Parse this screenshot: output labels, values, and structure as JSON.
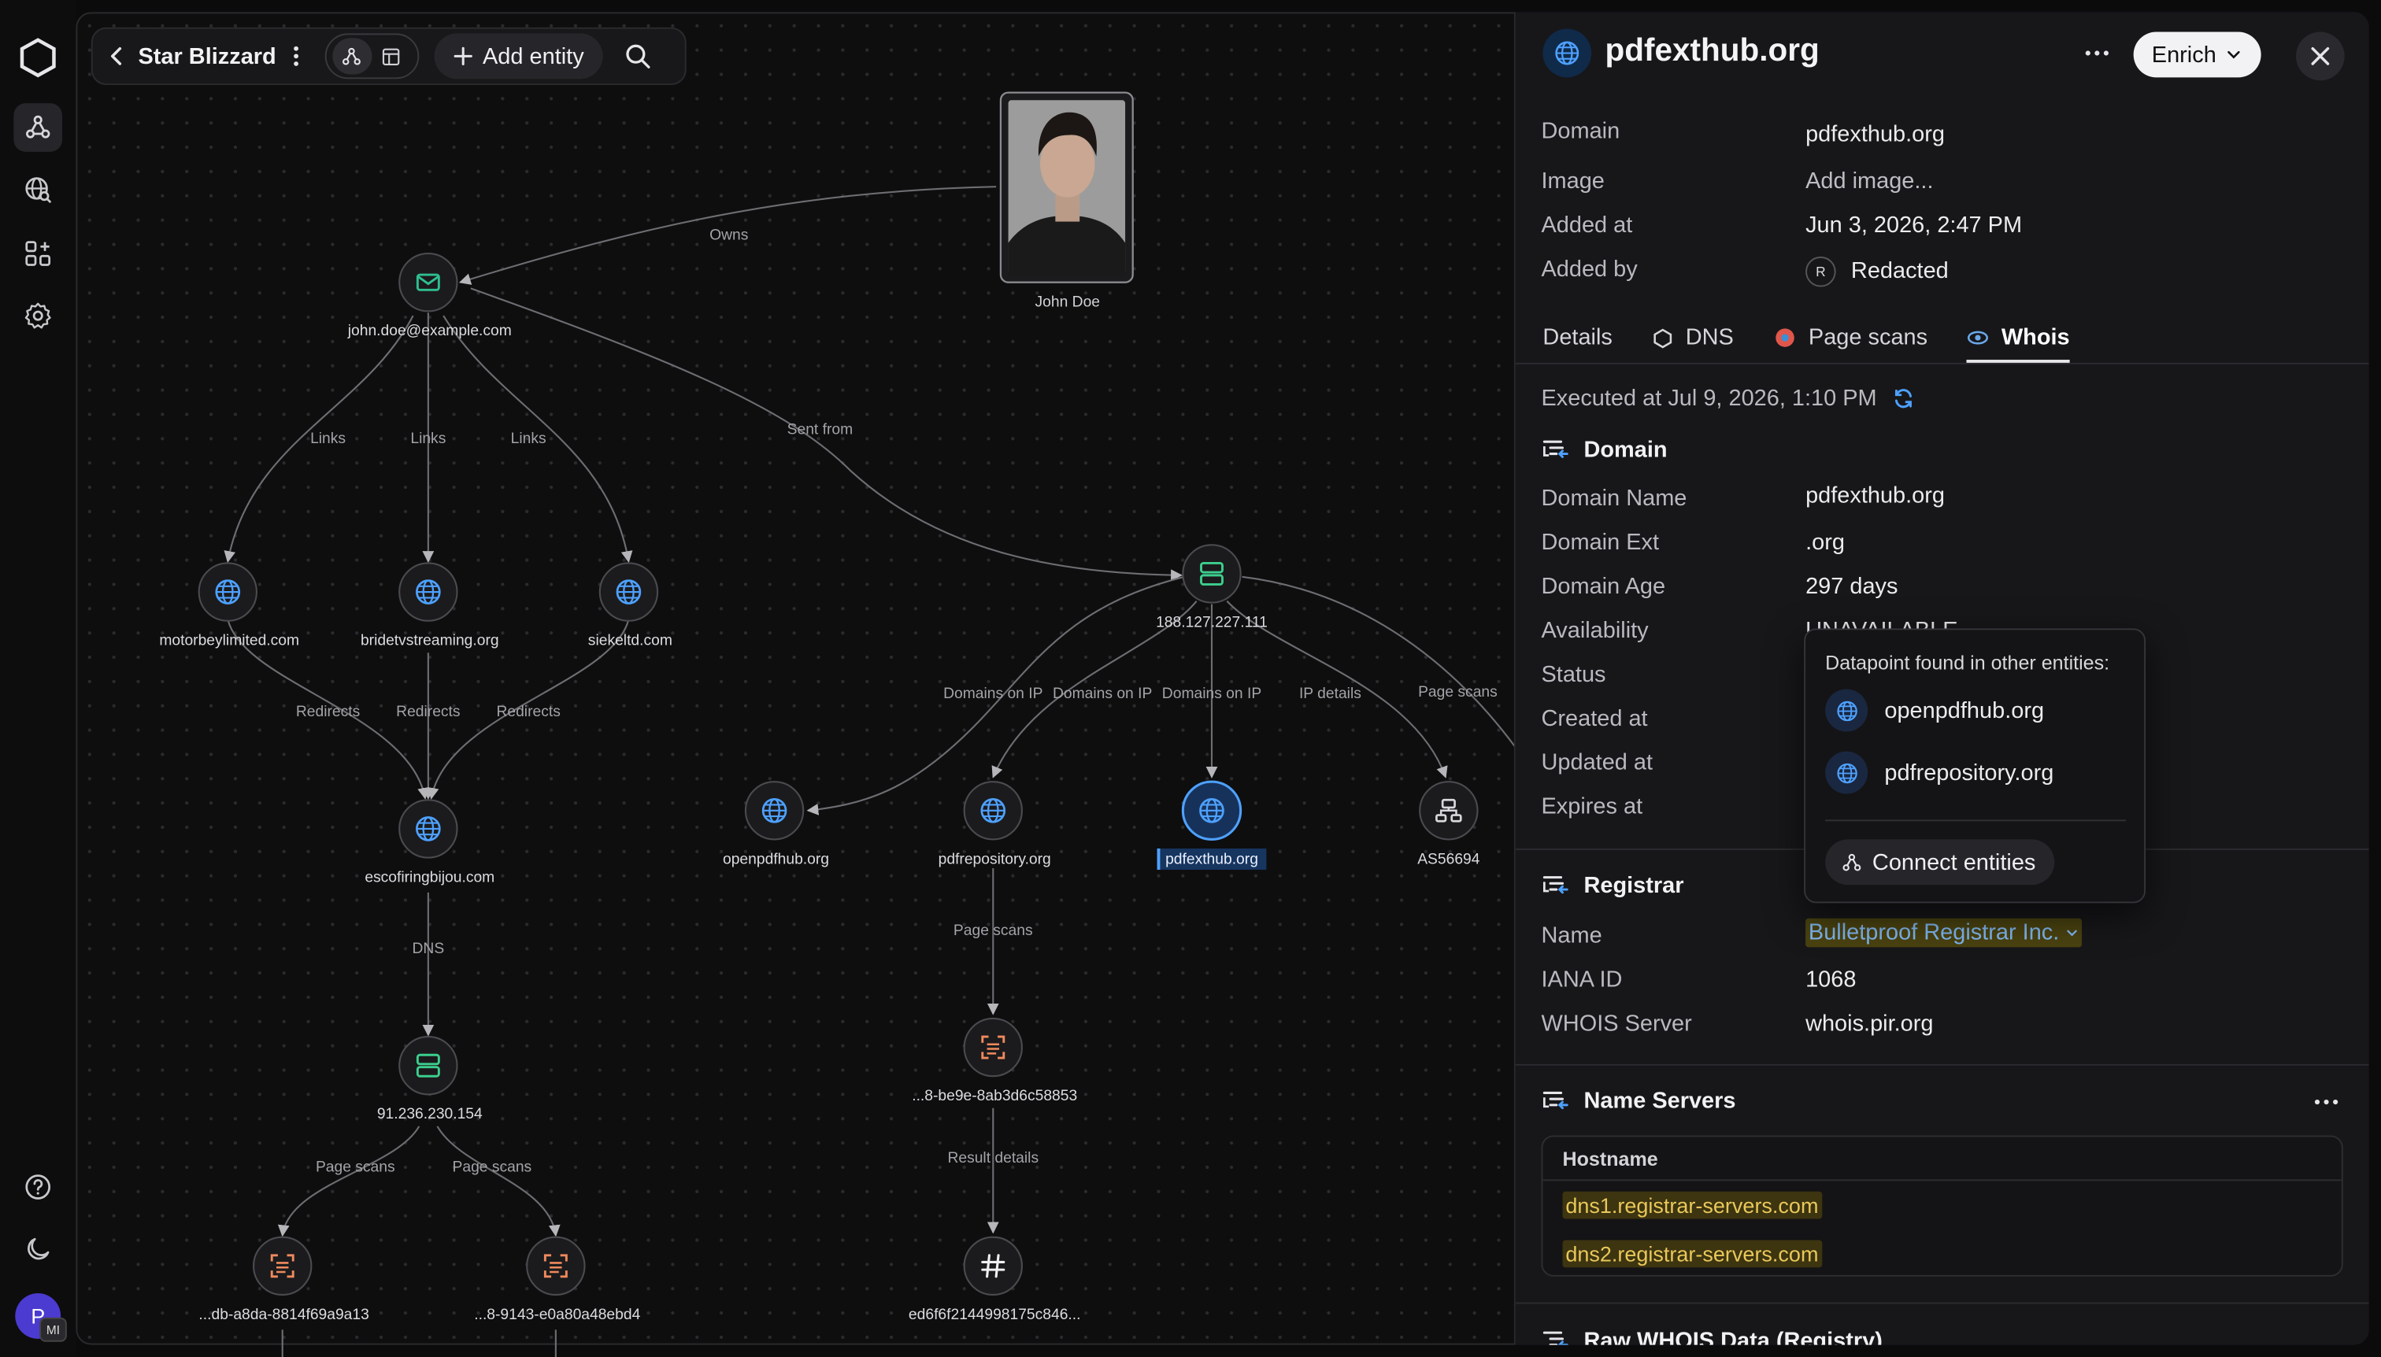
{
  "toolbar": {
    "title": "Star Blizzard",
    "add_entity": "Add entity"
  },
  "sidebar": {
    "items": [
      {
        "icon": "graph-icon",
        "active": true
      },
      {
        "icon": "globe-search-icon",
        "active": false
      },
      {
        "icon": "apps-grid-icon",
        "active": false
      },
      {
        "icon": "gear-icon",
        "active": false
      }
    ],
    "bottom": [
      {
        "icon": "help-icon"
      },
      {
        "icon": "moon-icon"
      }
    ],
    "avatar_letter": "P",
    "avatar_badge": "MI"
  },
  "graph": {
    "nodes": {
      "john_doe": "John Doe",
      "email": "john.doe@example.com",
      "motor": "motorbeylimited.com",
      "bride": "bridetvstreaming.org",
      "sieke": "siekeltd.com",
      "esco": "escofiringbijou.com",
      "ip1": "91.236.230.154",
      "scan1": "...db-a8da-8814f69a9a13",
      "scan2": "...8-9143-e0a80a48ebd4",
      "ip2": "188.127.227.111",
      "openpdf": "openpdfhub.org",
      "pdfrepo": "pdfrepository.org",
      "pdfext": "pdfexthub.org",
      "asn": "AS56694",
      "scan3": "...8-be9e-8ab3d6c58853",
      "hash": "ed6f6f2144998175c846..."
    },
    "edges": {
      "owns": "Owns",
      "sent_from": "Sent from",
      "links": "Links",
      "redirects": "Redirects",
      "dns": "DNS",
      "page_scans": "Page scans",
      "domains_on_ip": "Domains on IP",
      "ip_details": "IP details",
      "result_details": "Result details"
    }
  },
  "panel": {
    "title": "pdfexthub.org",
    "enrich": "Enrich",
    "meta": [
      {
        "k": "Domain",
        "v": "pdfexthub.org"
      },
      {
        "k": "Image",
        "v": "Add image..."
      },
      {
        "k": "Added at",
        "v": "Jun 3, 2026, 2:47 PM"
      },
      {
        "k": "Added by",
        "v": "Redacted",
        "badge": "R"
      }
    ],
    "tabs": [
      "Details",
      "DNS",
      "Page scans",
      "Whois"
    ],
    "active_tab": "Whois",
    "executed": "Executed at Jul 9, 2026, 1:10 PM",
    "domain_section": {
      "title": "Domain",
      "rows": [
        {
          "k": "Domain Name",
          "v": "pdfexthub.org"
        },
        {
          "k": "Domain Ext",
          "v": ".org"
        },
        {
          "k": "Domain Age",
          "v": "297 days"
        },
        {
          "k": "Availability",
          "v": "UNAVAILABLE"
        },
        {
          "k": "Status",
          "v": ""
        },
        {
          "k": "Created at",
          "v": ""
        },
        {
          "k": "Updated at",
          "v": ""
        },
        {
          "k": "Expires at",
          "v": ""
        }
      ]
    },
    "registrar_section": {
      "title": "Registrar",
      "rows": [
        {
          "k": "Name",
          "v": "Bulletproof Registrar Inc."
        },
        {
          "k": "IANA ID",
          "v": "1068"
        },
        {
          "k": "WHOIS Server",
          "v": "whois.pir.org"
        }
      ]
    },
    "ns_section": {
      "title": "Name Servers",
      "header": "Hostname",
      "rows": [
        "dns1.registrar-servers.com",
        "dns2.registrar-servers.com"
      ]
    },
    "raw_section": {
      "title": "Raw WHOIS Data (Registry)"
    }
  },
  "popover": {
    "title": "Datapoint found in other entities:",
    "items": [
      "openpdfhub.org",
      "pdfrepository.org"
    ],
    "button": "Connect entities"
  },
  "colors": {
    "domain_icon": "#4ea1ff",
    "email_icon": "#2fbf8f",
    "ip_icon": "#3ccf8e",
    "scan_icon": "#f08a5d",
    "highlight_yellow": "#e8c85a"
  }
}
